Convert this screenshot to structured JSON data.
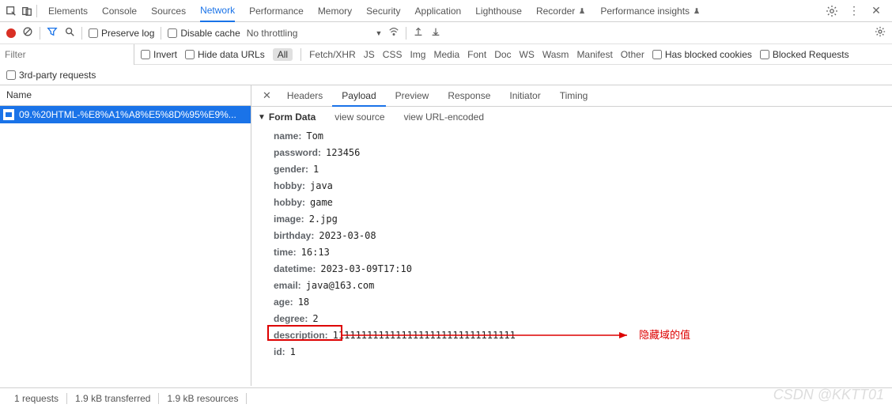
{
  "topbar": {
    "tabs": [
      "Elements",
      "Console",
      "Sources",
      "Network",
      "Performance",
      "Memory",
      "Security",
      "Application",
      "Lighthouse",
      "Recorder",
      "Performance insights"
    ],
    "active_tab_index": 3
  },
  "filterbar": {
    "preserve_log": "Preserve log",
    "disable_cache": "Disable cache",
    "throttling": "No throttling"
  },
  "filter_row": {
    "placeholder": "Filter",
    "invert": "Invert",
    "hide_data_urls": "Hide data URLs",
    "all": "All",
    "types": [
      "Fetch/XHR",
      "JS",
      "CSS",
      "Img",
      "Media",
      "Font",
      "Doc",
      "WS",
      "Wasm",
      "Manifest",
      "Other"
    ],
    "has_blocked": "Has blocked cookies",
    "blocked_requests": "Blocked Requests"
  },
  "third_party": "3rd-party requests",
  "left_panel": {
    "header": "Name",
    "request": "09.%20HTML-%E8%A1%A8%E5%8D%95%E9%..."
  },
  "detail_tabs": {
    "tabs": [
      "Headers",
      "Payload",
      "Preview",
      "Response",
      "Initiator",
      "Timing"
    ],
    "active_index": 1
  },
  "formdata": {
    "title": "Form Data",
    "view_source": "view source",
    "view_url_encoded": "view URL-encoded",
    "rows": [
      {
        "k": "name:",
        "v": "Tom"
      },
      {
        "k": "password:",
        "v": "123456"
      },
      {
        "k": "gender:",
        "v": "1"
      },
      {
        "k": "hobby:",
        "v": "java"
      },
      {
        "k": "hobby:",
        "v": "game"
      },
      {
        "k": "image:",
        "v": "2.jpg"
      },
      {
        "k": "birthday:",
        "v": "2023-03-08"
      },
      {
        "k": "time:",
        "v": "16:13"
      },
      {
        "k": "datetime:",
        "v": "2023-03-09T17:10"
      },
      {
        "k": "email:",
        "v": "java@163.com"
      },
      {
        "k": "age:",
        "v": "18"
      },
      {
        "k": "degree:",
        "v": "2"
      },
      {
        "k": "description:",
        "v": "11111111111111111111111111111111"
      },
      {
        "k": "id:",
        "v": "1"
      }
    ]
  },
  "annotation": "隐藏域的值",
  "statusbar": {
    "requests": "1 requests",
    "transferred": "1.9 kB transferred",
    "resources": "1.9 kB resources"
  },
  "watermark": "CSDN @KKTT01"
}
